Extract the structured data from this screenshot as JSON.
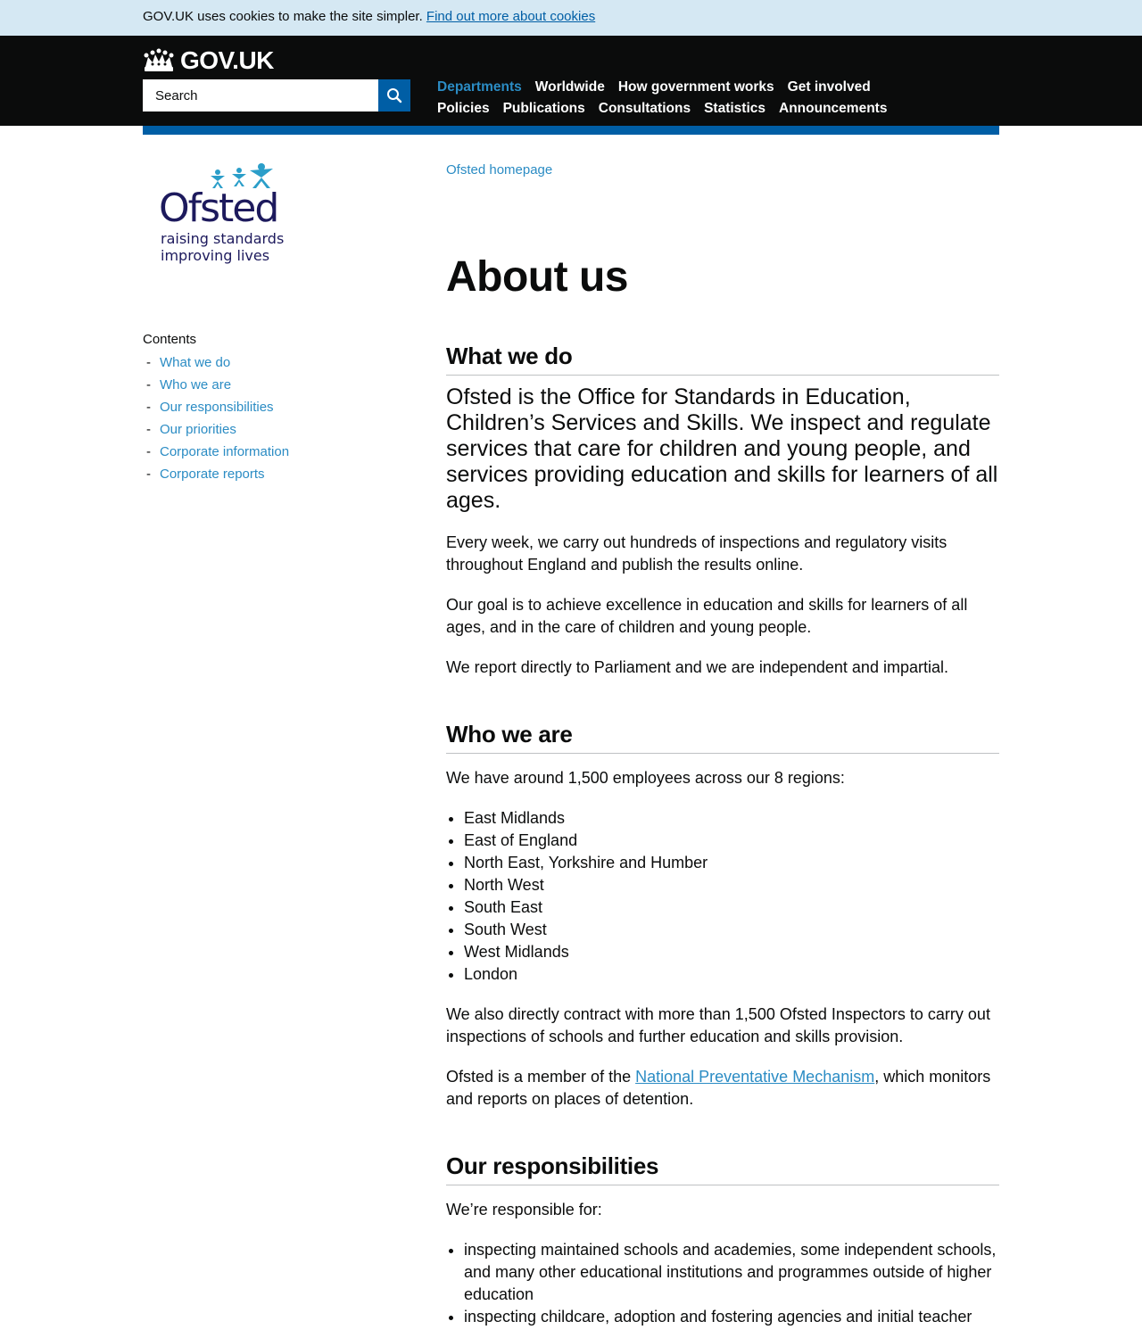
{
  "cookie_banner": {
    "text": "GOV.UK uses cookies to make the site simpler.",
    "link": "Find out more about cookies"
  },
  "header": {
    "logo_text": "GOV.UK",
    "search_placeholder": "Search",
    "nav_row1": [
      "Departments",
      "Worldwide",
      "How government works",
      "Get involved"
    ],
    "nav_row2": [
      "Policies",
      "Publications",
      "Consultations",
      "Statistics",
      "Announcements"
    ]
  },
  "org_logo": {
    "name": "Ofsted",
    "tagline_1": "raising standards",
    "tagline_2": "improving lives"
  },
  "contents": {
    "title": "Contents",
    "items": [
      "What we do",
      "Who we are",
      "Our responsibilities",
      "Our priorities",
      "Corporate information",
      "Corporate reports"
    ]
  },
  "breadcrumb": "Ofsted homepage",
  "page_title": "About us",
  "section_what": {
    "heading": "What we do",
    "lead": "Ofsted is the Office for Standards in Education, Children’s Services and Skills. We inspect and regulate services that care for children and young people, and services providing education and skills for learners of all ages.",
    "p1": "Every week, we carry out hundreds of inspections and regulatory visits throughout England and publish the results online.",
    "p2": "Our goal is to achieve excellence in education and skills for learners of all ages, and in the care of children and young people.",
    "p3": "We report directly to Parliament and we are independent and impartial."
  },
  "section_who": {
    "heading": "Who we are",
    "p1": "We have around 1,500 employees across our 8 regions:",
    "regions": [
      "East Midlands",
      "East of England",
      "North East, Yorkshire and Humber",
      "North West",
      "South East",
      "South West",
      "West Midlands",
      "London"
    ],
    "p2": "We also directly contract with more than 1,500 Ofsted Inspectors to carry out inspections of schools and further education and skills provision.",
    "p3_before": "Ofsted is a member of the ",
    "p3_link": "National Preventative Mechanism",
    "p3_after": ", which monitors and reports on places of detention."
  },
  "section_resp": {
    "heading": "Our responsibilities",
    "p1": "We’re responsible for:",
    "items": [
      "inspecting maintained schools and academies, some independent schools, and many other educational institutions and programmes outside of higher education",
      "inspecting childcare, adoption and fostering agencies and initial teacher"
    ]
  },
  "colors": {
    "banner_bg": "#d5e8f3",
    "header_bg": "#0b0c0c",
    "brand_blue": "#005ea5",
    "link": "#2b8cc4",
    "ofsted_navy": "#1d1a5d",
    "ofsted_teal": "#2b9ec9"
  }
}
